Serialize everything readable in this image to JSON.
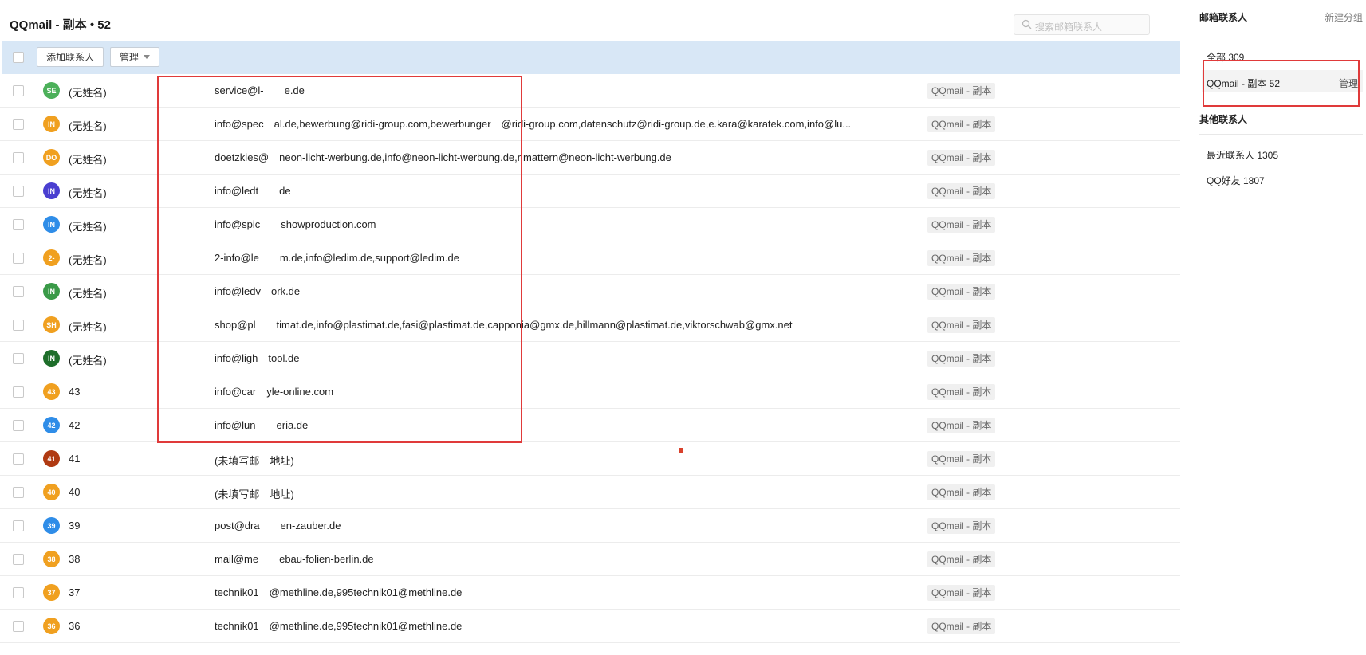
{
  "header": {
    "title": "QQmail - 副本 • 52"
  },
  "search": {
    "placeholder": "搜索邮箱联系人"
  },
  "toolbar": {
    "add_label": "添加联系人",
    "manage_label": "管理"
  },
  "contacts": [
    {
      "avatar": "SE",
      "color": "#4cb05a",
      "name": "(无姓名)",
      "email": "service@l-  e.de",
      "group": "QQmail - 副本"
    },
    {
      "avatar": "IN",
      "color": "#f0a020",
      "name": "(无姓名)",
      "email": "info@spec al.de,bewerbung@ridi-group.com,bewerbunger @ridi-group.com,datenschutz@ridi-group.de,e.kara@karatek.com,info@lu...",
      "group": "QQmail - 副本"
    },
    {
      "avatar": "DO",
      "color": "#f0a020",
      "name": "(无姓名)",
      "email": "doetzkies@ neon-licht-werbung.de,info@neon-licht-werbung.de,r.mattern@neon-licht-werbung.de",
      "group": "QQmail - 副本"
    },
    {
      "avatar": "IN",
      "color": "#4a3fd0",
      "name": "(无姓名)",
      "email": "info@ledt  de",
      "group": "QQmail - 副本"
    },
    {
      "avatar": "IN",
      "color": "#2f8de8",
      "name": "(无姓名)",
      "email": "info@spic  showproduction.com",
      "group": "QQmail - 副本"
    },
    {
      "avatar": "2-",
      "color": "#f0a020",
      "name": "(无姓名)",
      "email": "2-info@le  m.de,info@ledim.de,support@ledim.de",
      "group": "QQmail - 副本"
    },
    {
      "avatar": "IN",
      "color": "#3a9a48",
      "name": "(无姓名)",
      "email": "info@ledv ork.de",
      "group": "QQmail - 副本"
    },
    {
      "avatar": "SH",
      "color": "#f0a020",
      "name": "(无姓名)",
      "email": "shop@pl  timat.de,info@plastimat.de,fasi@plastimat.de,capponia@gmx.de,hillmann@plastimat.de,viktorschwab@gmx.net",
      "group": "QQmail - 副本"
    },
    {
      "avatar": "IN",
      "color": "#1e6e2a",
      "name": "(无姓名)",
      "email": "info@ligh tool.de",
      "group": "QQmail - 副本"
    },
    {
      "avatar": "43",
      "color": "#f0a020",
      "name": "43",
      "email": "info@car yle-online.com",
      "group": "QQmail - 副本"
    },
    {
      "avatar": "42",
      "color": "#2f8de8",
      "name": "42",
      "email": "info@lun  eria.de",
      "group": "QQmail - 副本"
    },
    {
      "avatar": "41",
      "color": "#b03a12",
      "name": "41",
      "email": "(未填写邮 地址)",
      "group": "QQmail - 副本"
    },
    {
      "avatar": "40",
      "color": "#f0a020",
      "name": "40",
      "email": "(未填写邮 地址)",
      "group": "QQmail - 副本"
    },
    {
      "avatar": "39",
      "color": "#2f8de8",
      "name": "39",
      "email": "post@dra  en-zauber.de",
      "group": "QQmail - 副本"
    },
    {
      "avatar": "38",
      "color": "#f0a020",
      "name": "38",
      "email": "mail@me  ebau-folien-berlin.de",
      "group": "QQmail - 副本"
    },
    {
      "avatar": "37",
      "color": "#f0a020",
      "name": "37",
      "email": "technik01 @methline.de,995technik01@methline.de",
      "group": "QQmail - 副本"
    },
    {
      "avatar": "36",
      "color": "#f0a020",
      "name": "36",
      "email": "technik01 @methline.de,995technik01@methline.de",
      "group": "QQmail - 副本"
    }
  ],
  "sidebar": {
    "title": "邮箱联系人",
    "new_group": "新建分组",
    "all": "全部  309",
    "active_group": "QQmail - 副本  52",
    "manage": "管理",
    "other_title": "其他联系人",
    "recent": "最近联系人  1305",
    "qq_friends": "QQ好友  1807"
  }
}
